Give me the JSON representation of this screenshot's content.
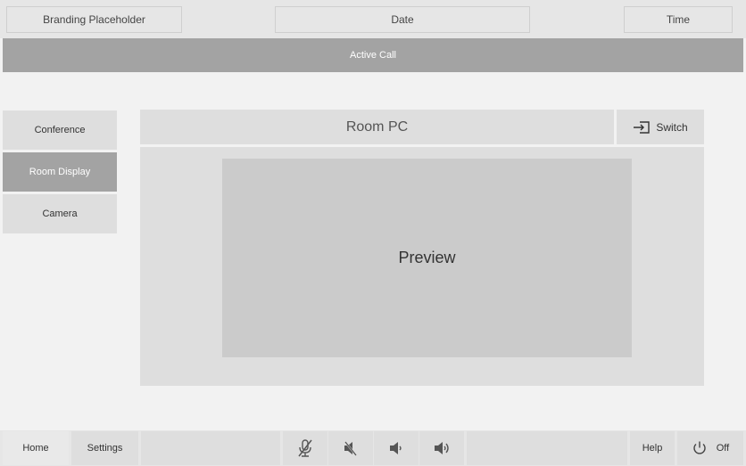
{
  "header": {
    "branding": "Branding Placeholder",
    "date": "Date",
    "time": "Time"
  },
  "status_bar": {
    "label": "Active Call"
  },
  "sidebar": {
    "items": [
      {
        "label": "Conference",
        "active": false
      },
      {
        "label": "Room Display",
        "active": true
      },
      {
        "label": "Camera",
        "active": false
      }
    ]
  },
  "main": {
    "source_title": "Room PC",
    "switch_label": "Switch",
    "switch_icon": "input-switch-icon",
    "preview_label": "Preview"
  },
  "footer": {
    "home_label": "Home",
    "settings_label": "Settings",
    "audio_icons": [
      "mic-mute-icon",
      "speaker-mute-icon",
      "volume-down-icon",
      "volume-up-icon"
    ],
    "help_label": "Help",
    "power_label": "Off",
    "power_icon": "power-icon"
  },
  "colors": {
    "accent_gray": "#a3a3a3",
    "panel": "#dedede",
    "preview": "#cbcbcb",
    "background": "#f2f2f2"
  }
}
